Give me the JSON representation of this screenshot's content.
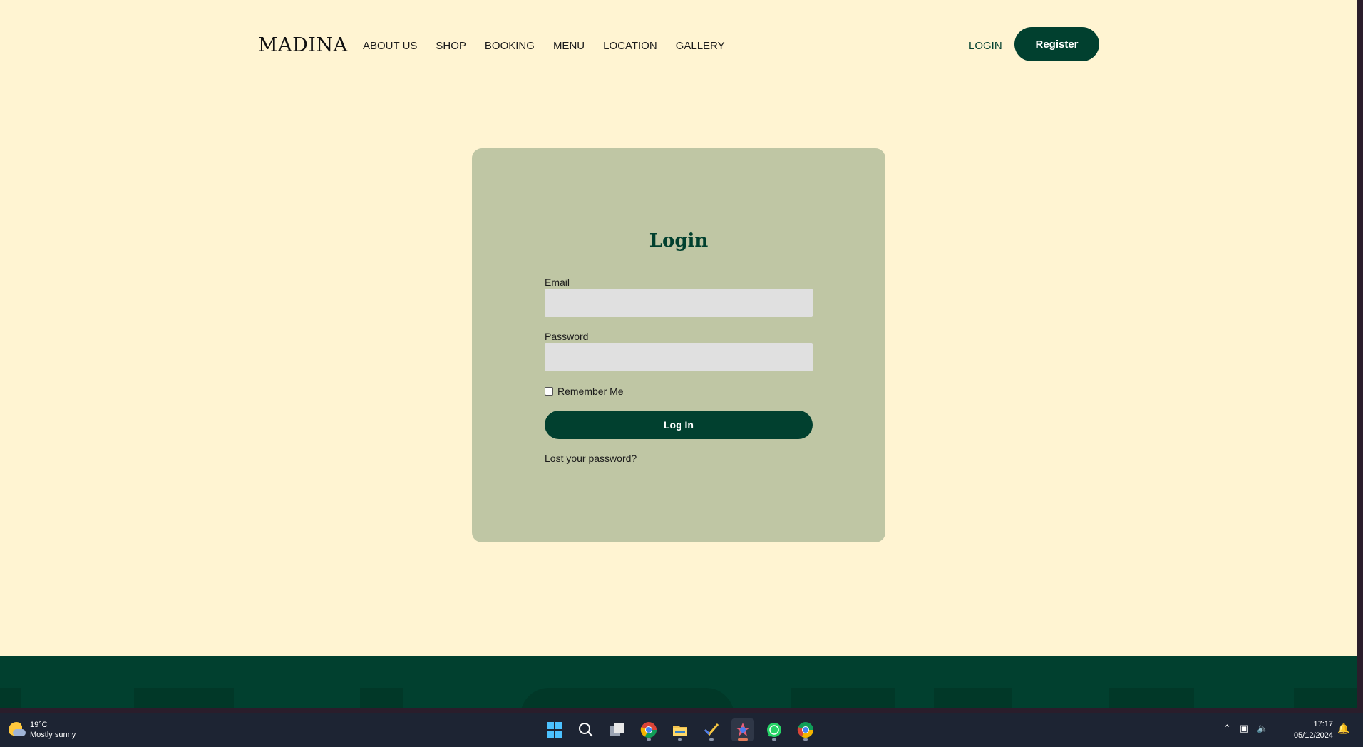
{
  "header": {
    "brand": "MADINA",
    "nav": [
      "ABOUT US",
      "SHOP",
      "BOOKING",
      "MENU",
      "LOCATION",
      "GALLERY"
    ],
    "login_label": "LOGIN",
    "register_label": "Register"
  },
  "login_form": {
    "title": "Login",
    "email_label": "Email",
    "email_value": "",
    "password_label": "Password",
    "password_value": "",
    "remember_label": "Remember Me",
    "remember_checked": false,
    "submit_label": "Log In",
    "lost_password_label": "Lost your password?"
  },
  "colors": {
    "page_background": "#fff4d2",
    "card_background": "#bfc6a4",
    "brand_green": "#01402f",
    "input_background": "#e0e0e0",
    "taskbar_background": "#1d2433"
  },
  "taskbar": {
    "weather": {
      "temperature": "19°C",
      "condition": "Mostly sunny"
    },
    "apps": [
      {
        "name": "windows-start-icon"
      },
      {
        "name": "search-icon"
      },
      {
        "name": "task-view-icon"
      },
      {
        "name": "chrome-icon"
      },
      {
        "name": "file-explorer-icon"
      },
      {
        "name": "todo-icon"
      },
      {
        "name": "paint-app-icon",
        "active": true
      },
      {
        "name": "whatsapp-icon"
      },
      {
        "name": "chrome-alt-icon"
      }
    ],
    "time": "17:17",
    "date": "05/12/2024"
  }
}
